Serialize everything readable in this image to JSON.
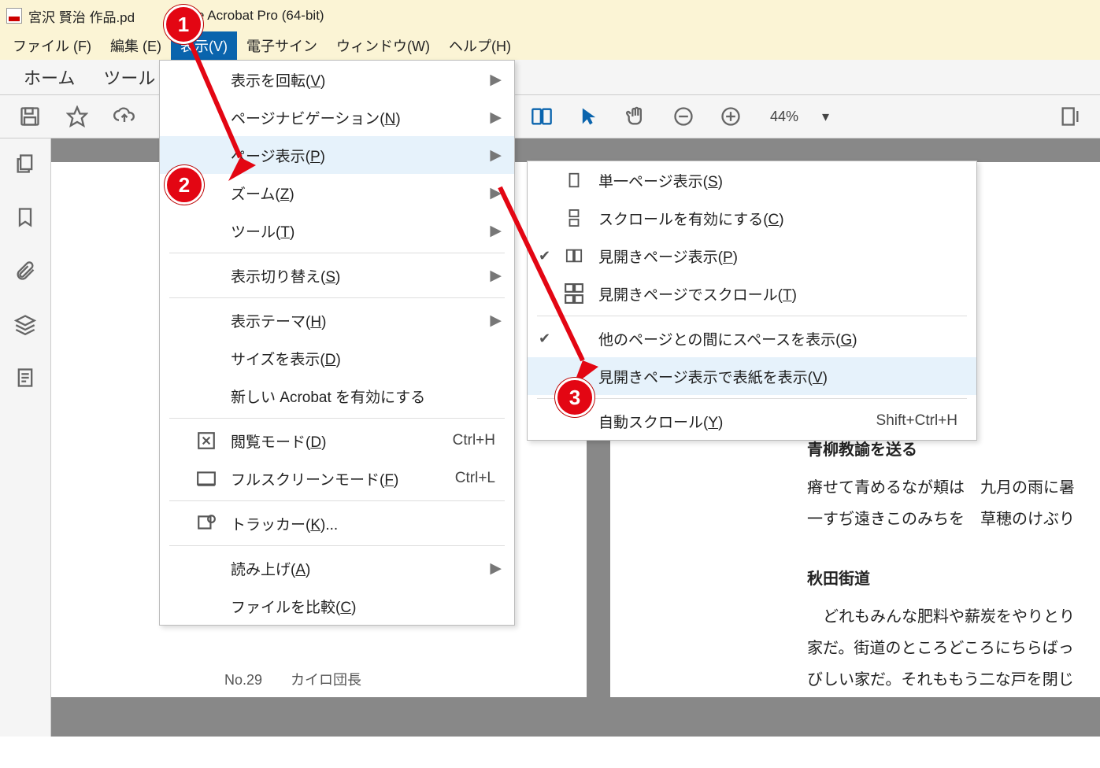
{
  "window": {
    "title": "宮沢 賢治 作品.pd",
    "title_after": "obe Acrobat Pro (64-bit)"
  },
  "menubar": [
    {
      "label": "ファイル (F)"
    },
    {
      "label": "編集 (E)"
    },
    {
      "label": "表示(V)",
      "active": true
    },
    {
      "label": "電子サイン"
    },
    {
      "label": "ウィンドウ(W)"
    },
    {
      "label": "ヘルプ(H)"
    }
  ],
  "tabs": {
    "home": "ホーム",
    "tools": "ツール"
  },
  "toolbar": {
    "zoom": "44%"
  },
  "viewMenu": {
    "items": [
      {
        "id": "rotate",
        "label": "表示を回転(",
        "u": "V",
        "suffix": ")",
        "arrow": true
      },
      {
        "id": "pagenav",
        "label": "ページナビゲーション(",
        "u": "N",
        "suffix": ")",
        "arrow": true
      },
      {
        "id": "pagedisp",
        "label": "ページ表示(",
        "u": "P",
        "suffix": ")",
        "arrow": true,
        "hl": true
      },
      {
        "id": "zoom",
        "label": "ズーム(",
        "u": "Z",
        "suffix": ")",
        "arrow": true
      },
      {
        "id": "tools",
        "label": "ツール(",
        "u": "T",
        "suffix": ")",
        "arrow": true,
        "sep": true
      },
      {
        "id": "switch",
        "label": "表示切り替え(",
        "u": "S",
        "suffix": ")",
        "arrow": true,
        "sep": true
      },
      {
        "id": "theme",
        "label": "表示テーマ(",
        "u": "H",
        "suffix": ")",
        "arrow": true
      },
      {
        "id": "size",
        "label": "サイズを表示(",
        "u": "D",
        "suffix": ")"
      },
      {
        "id": "newacro",
        "label": "新しい Acrobat を有効にする",
        "sep": true
      },
      {
        "id": "read",
        "label": "閲覧モード(",
        "u": "D",
        "suffix": ")",
        "icon": "read",
        "sc": "Ctrl+H"
      },
      {
        "id": "full",
        "label": "フルスクリーンモード(",
        "u": "F",
        "suffix": ")",
        "icon": "full",
        "sc": "Ctrl+L",
        "sep": true
      },
      {
        "id": "tracker",
        "label": "トラッカー(",
        "u": "K",
        "suffix": ")...",
        "icon": "tracker",
        "sep": true
      },
      {
        "id": "readaloud",
        "label": "読み上げ(",
        "u": "A",
        "suffix": ")",
        "arrow": true
      },
      {
        "id": "compare",
        "label": "ファイルを比較(",
        "u": "C",
        "suffix": ")"
      }
    ]
  },
  "pageDisplayMenu": {
    "items": [
      {
        "id": "single",
        "label": "単一ページ表示(",
        "u": "S",
        "suffix": ")",
        "icon": "single"
      },
      {
        "id": "scroll",
        "label": "スクロールを有効にする(",
        "u": "C",
        "suffix": ")",
        "icon": "scroll"
      },
      {
        "id": "two",
        "label": "見開きページ表示(",
        "u": "P",
        "suffix": ")",
        "icon": "two",
        "check": true
      },
      {
        "id": "twoscroll",
        "label": "見開きページでスクロール(",
        "u": "T",
        "suffix": ")",
        "icon": "twoscroll",
        "sep": true
      },
      {
        "id": "gap",
        "label": "他のページとの間にスペースを表示(",
        "u": "G",
        "suffix": ")",
        "check": true
      },
      {
        "id": "cover",
        "label": "見開きページ表示で表紙を表示(",
        "u": "V",
        "suffix": ")",
        "hl": true,
        "sep": true
      },
      {
        "id": "auto",
        "label": "自動スクロール(",
        "u": "Y",
        "suffix": ")",
        "sc": "Shift+Ctrl+H"
      }
    ]
  },
  "doc": {
    "h1": "青柳教諭を送る",
    "l1": "瘠せて青めるなが頬は    九月の雨に暑",
    "l2": "一すぢ遠きこのみちを    草穂のけぶり",
    "h2": "秋田街道",
    "p1": "　どれもみんな肥料や薪炭をやりとり",
    "p2": "家だ。街道のところどころにちらばっ",
    "p3": "びしい家だ。それももう二な戸を閉じ",
    "tag": "No.29　　カイロ団長"
  },
  "badges": {
    "b1": "1",
    "b2": "2",
    "b3": "3"
  },
  "icons": {
    "arrow_right": "▶",
    "check": "✔",
    "dropdown": "▾"
  }
}
